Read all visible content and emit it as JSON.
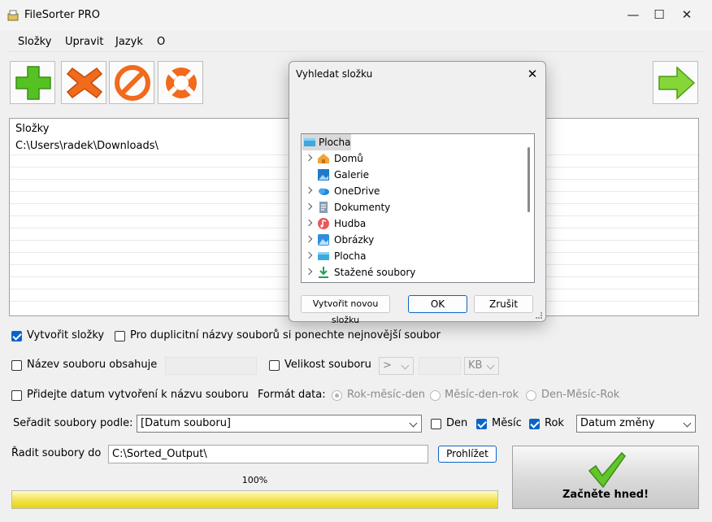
{
  "app": {
    "title": "FileSorter PRO"
  },
  "window_controls": {
    "minimize": "—",
    "maximize": "☐",
    "close": "✕"
  },
  "menu": [
    "Složky",
    "Upravit",
    "Jazyk",
    "O"
  ],
  "toolbar": {
    "icons": [
      "add-icon",
      "remove-icon",
      "clear-icon",
      "help-icon",
      "next-arrow-icon"
    ],
    "colors": {
      "green": "#55c223",
      "orange": "#f26a1b"
    }
  },
  "folders": {
    "header": "Složky",
    "items": [
      "C:\\Users\\radek\\Downloads\\"
    ]
  },
  "options": {
    "create_folders": {
      "label": "Vytvořit složky",
      "checked": true
    },
    "keep_newest": {
      "label": "Pro duplicitní názvy souborů si ponechte nejnovější soubor",
      "checked": false
    },
    "name_contains": {
      "label": "Název souboru obsahuje",
      "checked": false,
      "value": ""
    },
    "file_size": {
      "label": "Velikost souboru",
      "checked": false,
      "operator": ">",
      "value": "",
      "unit": "KB"
    },
    "add_date": {
      "label": "Přidejte datum vytvoření k názvu souboru",
      "checked": false
    },
    "date_format": {
      "label": "Formát data:",
      "choices": [
        "Rok-měsíc-den",
        "Měsíc-den-rok",
        "Den-Měsíc-Rok"
      ],
      "selected": "Rok-měsíc-den"
    },
    "sort_by": {
      "label": "Seřadit soubory podle:",
      "value": "[Datum souboru]"
    },
    "day": {
      "label": "Den",
      "checked": false
    },
    "month": {
      "label": "Měsíc",
      "checked": true
    },
    "year": {
      "label": "Rok",
      "checked": true
    },
    "date_type": {
      "value": "Datum změny"
    },
    "output": {
      "label": "Řadit soubory do",
      "value": "C:\\Sorted_Output\\",
      "browse": "Prohlížet"
    }
  },
  "progress": {
    "label": "100%",
    "value": 100
  },
  "start": {
    "label": "Začněte hned!"
  },
  "dialog": {
    "title": "Vyhledat složku",
    "close": "✕",
    "tree": [
      {
        "label": "Plocha",
        "icon": "desktop-icon",
        "expandable": false,
        "selected": true
      },
      {
        "label": "Domů",
        "icon": "home-icon",
        "expandable": true
      },
      {
        "label": "Galerie",
        "icon": "gallery-icon",
        "expandable": false
      },
      {
        "label": "OneDrive",
        "icon": "onedrive-icon",
        "expandable": true
      },
      {
        "label": "Dokumenty",
        "icon": "documents-icon",
        "expandable": true
      },
      {
        "label": "Hudba",
        "icon": "music-icon",
        "expandable": true
      },
      {
        "label": "Obrázky",
        "icon": "pictures-icon",
        "expandable": true
      },
      {
        "label": "Plocha",
        "icon": "desktop-icon",
        "expandable": true
      },
      {
        "label": "Stažené soubory",
        "icon": "downloads-icon",
        "expandable": true
      }
    ],
    "new_folder": "Vytvořit novou složku",
    "ok": "OK",
    "cancel": "Zrušit"
  }
}
